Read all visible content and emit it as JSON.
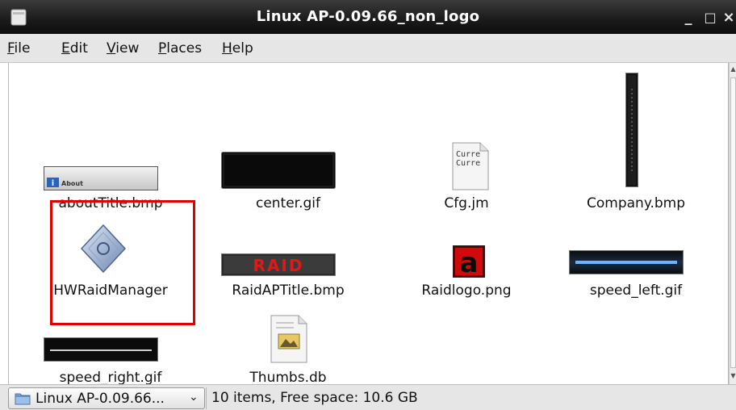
{
  "window": {
    "title": "Linux AP-0.09.66_non_logo",
    "minimize": "_",
    "maximize": "□",
    "close": "×"
  },
  "menu": [
    {
      "label": "File",
      "accel": "F",
      "rest": "ile"
    },
    {
      "label": "Edit",
      "accel": "E",
      "rest": "dit"
    },
    {
      "label": "View",
      "accel": "V",
      "rest": "iew"
    },
    {
      "label": "Places",
      "accel": "P",
      "rest": "laces"
    },
    {
      "label": "Help",
      "accel": "H",
      "rest": "elp"
    }
  ],
  "files": [
    {
      "name": "aboutTitle.bmp",
      "icon": "about-bar-image",
      "thumb_text": "About"
    },
    {
      "name": "center.gif",
      "icon": "black-bar-image"
    },
    {
      "name": "Cfg.jm",
      "icon": "text-file-icon",
      "thumb_text": [
        "Curre",
        "Curre"
      ]
    },
    {
      "name": "Company.bmp",
      "icon": "vertical-strip-image"
    },
    {
      "name": "HWRaidManager",
      "icon": "executable-diamond-icon"
    },
    {
      "name": "RaidAPTitle.bmp",
      "icon": "raid-title-image",
      "thumb_text": "RAID"
    },
    {
      "name": "Raidlogo.png",
      "icon": "raid-logo-image",
      "thumb_text": "a"
    },
    {
      "name": "speed_left.gif",
      "icon": "speed-bar-image"
    },
    {
      "name": "speed_right.gif",
      "icon": "speed-bar-image"
    },
    {
      "name": "Thumbs.db",
      "icon": "thumbs-db-icon"
    }
  ],
  "statusbar": {
    "location": "Linux AP-0.09.66...",
    "location_chevron": "⌄",
    "info": "10 items, Free space: 10.6 GB"
  },
  "colors": {
    "titlebar": "#1c1c1c",
    "menubar": "#e6e6e6",
    "highlight": "#e00000",
    "speed_bar_glow": "#6fb2ff",
    "raid_red": "#e01818"
  }
}
